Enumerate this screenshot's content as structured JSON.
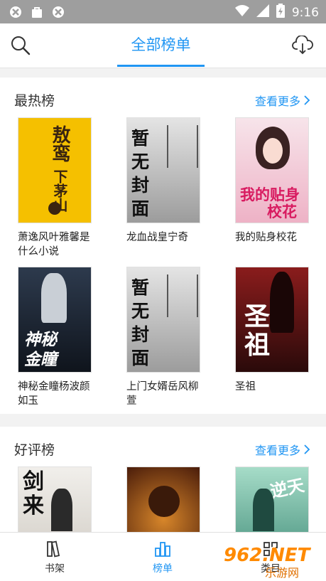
{
  "status": {
    "time": "9:16"
  },
  "header": {
    "title": "全部榜单"
  },
  "sections": [
    {
      "title": "最热榜",
      "more": "查看更多",
      "books": [
        {
          "title": "萧逸风叶雅馨是什么小说",
          "cover_text": "敖鸾下茅山",
          "cover_bg": "#f7c400"
        },
        {
          "title": "龙血战皇宁奇",
          "cover_text": "暂无封面",
          "cover_bg": "#cfcfcf"
        },
        {
          "title": "我的贴身校花",
          "cover_text": "我的贴身校花",
          "cover_bg": "#f3c9d8"
        },
        {
          "title": "神秘金瞳杨波颜如玉",
          "cover_text": "神秘金瞳",
          "cover_bg": "#1f2a38"
        },
        {
          "title": "上门女婿岳风柳萱",
          "cover_text": "暂无封面",
          "cover_bg": "#cfcfcf"
        },
        {
          "title": "圣祖",
          "cover_text": "圣祖",
          "cover_bg": "#5a1212"
        }
      ]
    },
    {
      "title": "好评榜",
      "more": "查看更多",
      "books": [
        {
          "title": "",
          "cover_text": "剑来",
          "cover_bg": "#e8e6e2"
        },
        {
          "title": "",
          "cover_text": "",
          "cover_bg": "#6b2e12"
        },
        {
          "title": "",
          "cover_text": "逆天邪神",
          "cover_bg": "#4f9a8c"
        }
      ]
    }
  ],
  "nav": {
    "bookshelf": "书架",
    "ranking": "榜单",
    "category": "类目"
  },
  "colors": {
    "accent": "#2196f3"
  },
  "watermark": {
    "big": "962.NET",
    "small": "乐游网"
  }
}
